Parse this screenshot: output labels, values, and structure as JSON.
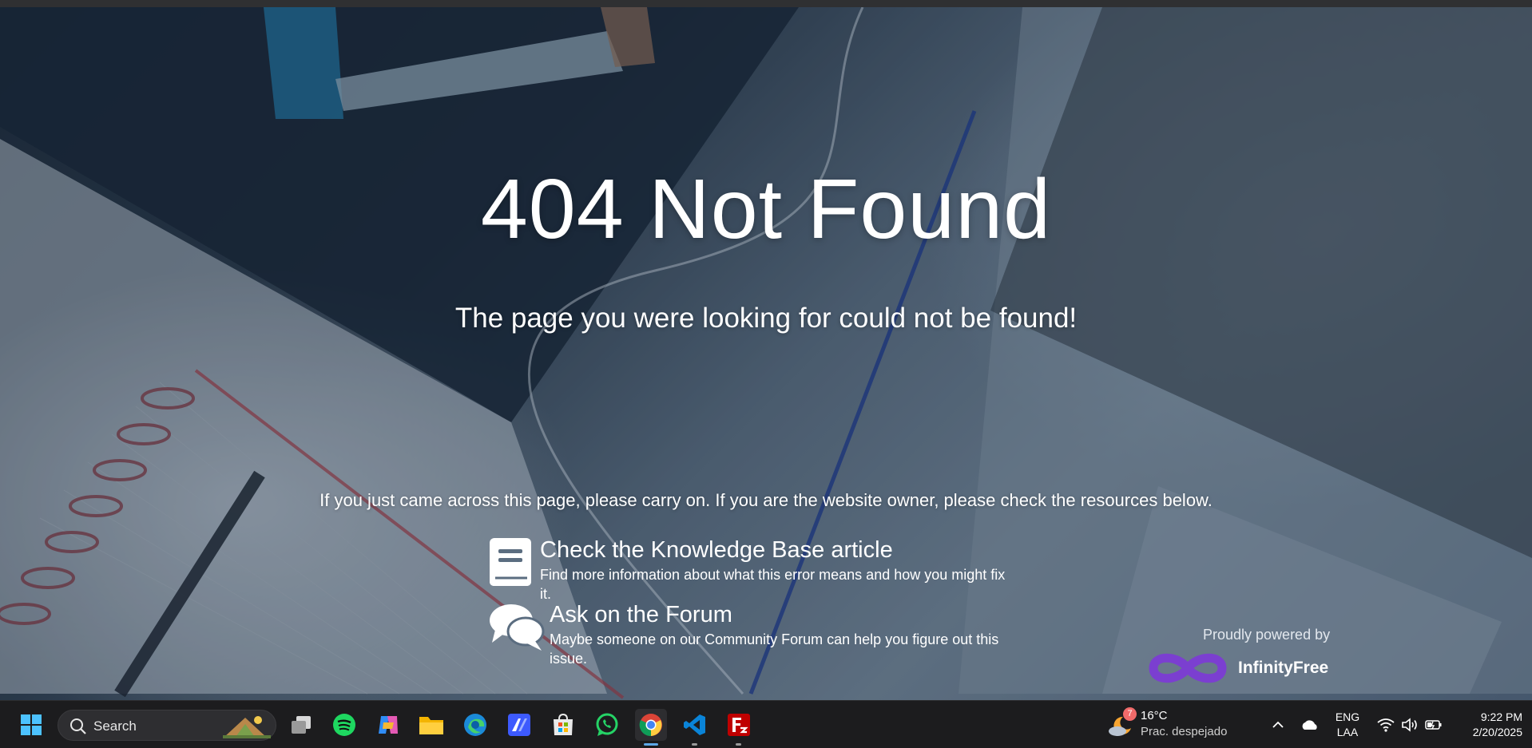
{
  "page": {
    "title": "404 Not Found",
    "subtitle": "The page you were looking for could not be found!",
    "notice": "If you just came across this page, please carry on. If you are the website owner, please check the resources below.",
    "resources": [
      {
        "title": "Check the Knowledge Base article",
        "description": "Find more information about what this error means and how you might fix it.",
        "icon": "book-icon"
      },
      {
        "title": "Ask on the Forum",
        "description": "Maybe someone on our Community Forum can help you figure out this issue.",
        "icon": "chat-bubbles-icon"
      }
    ],
    "powered_label": "Proudly powered by",
    "brand": "InfinityFree"
  },
  "taskbar": {
    "search_label": "Search",
    "apps": [
      "start-icon",
      "task-view-icon",
      "spotify-icon",
      "copilot-icon",
      "file-explorer-icon",
      "edge-icon",
      "app-icon",
      "store-icon",
      "whatsapp-icon",
      "chrome-icon",
      "vscode-icon",
      "filezilla-icon"
    ],
    "weather": {
      "temp": "16°C",
      "desc": "Prac. despejado",
      "badge": "7"
    },
    "language": {
      "lang": "ENG",
      "layout": "LAA"
    },
    "clock": {
      "time": "9:22 PM",
      "date": "2/20/2025"
    }
  },
  "colors": {
    "brand_purple": "#7b3fd0",
    "taskbar": "#1c1c1e"
  }
}
